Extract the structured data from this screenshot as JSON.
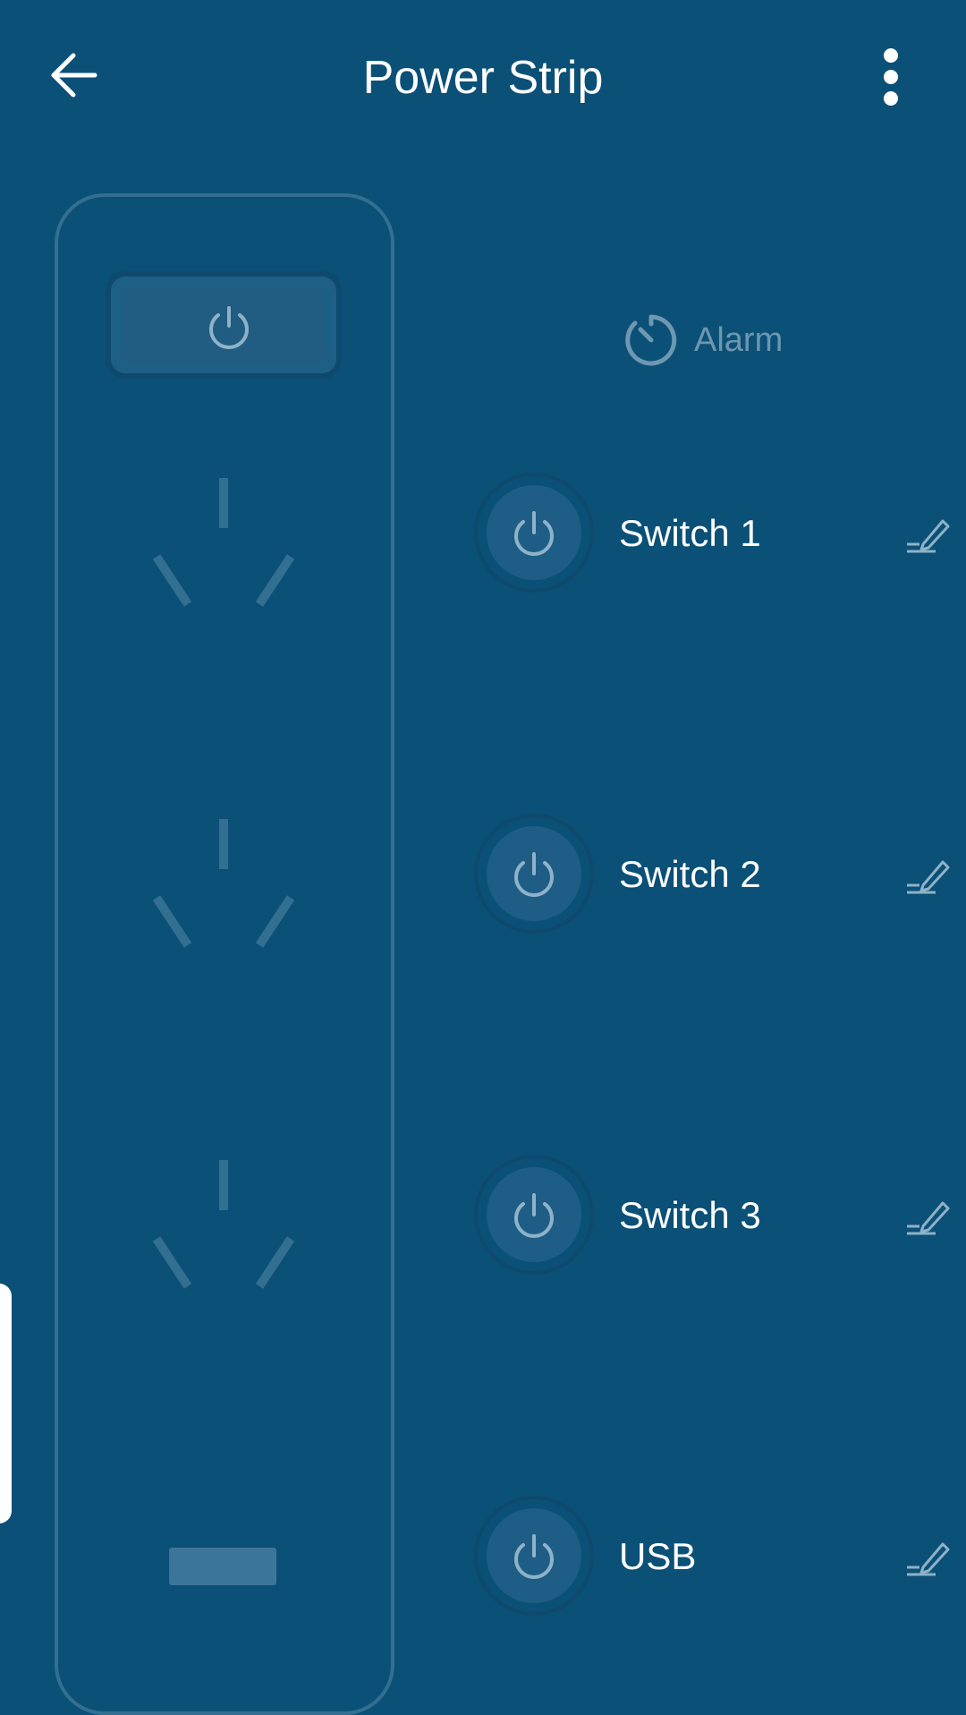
{
  "header": {
    "title": "Power Strip",
    "back_icon": "arrow-left-icon",
    "menu_icon": "more-vertical-icon"
  },
  "alarm": {
    "label": "Alarm",
    "icon": "timer-icon"
  },
  "switches": [
    {
      "label": "Switch 1",
      "icon": "power-icon"
    },
    {
      "label": "Switch 2",
      "icon": "power-icon"
    },
    {
      "label": "Switch 3",
      "icon": "power-icon"
    },
    {
      "label": "USB",
      "icon": "power-icon"
    }
  ],
  "colors": {
    "background": "#0b5077",
    "strip_outline": "#336f91",
    "button_fill": "#1e5e86",
    "icon_muted": "#8fb2c8",
    "text": "#ffffff"
  }
}
